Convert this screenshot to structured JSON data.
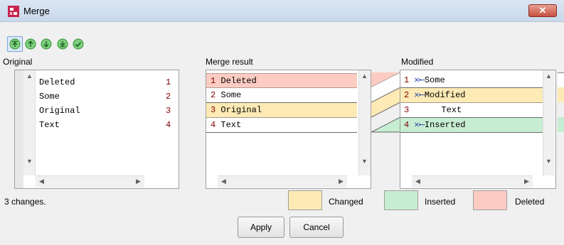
{
  "window": {
    "title": "Merge",
    "close_glyph": "✕"
  },
  "toolbar": {
    "buttons": [
      {
        "icon": "move-first-icon"
      },
      {
        "icon": "move-up-icon"
      },
      {
        "icon": "move-down-icon"
      },
      {
        "icon": "move-last-icon"
      },
      {
        "icon": "accept-icon"
      }
    ]
  },
  "original": {
    "label": "Original",
    "lines": [
      {
        "text": "Deleted",
        "num": "1"
      },
      {
        "text": "Some",
        "num": "2"
      },
      {
        "text": "Original",
        "num": "3"
      },
      {
        "text": "Text",
        "num": "4"
      }
    ]
  },
  "merge_result": {
    "label": "Merge result",
    "lines": [
      {
        "num": "1",
        "text": "Deleted",
        "state": "deleted"
      },
      {
        "num": "2",
        "text": "Some",
        "state": "none"
      },
      {
        "num": "3",
        "text": "Original",
        "state": "changed"
      },
      {
        "num": "4",
        "text": "Text",
        "state": "none"
      }
    ]
  },
  "modified": {
    "label": "Modified",
    "lines": [
      {
        "num": "1",
        "marker": "✕⟵",
        "text": "Some",
        "state": "none"
      },
      {
        "num": "2",
        "marker": "✕⟵",
        "text": "Modified",
        "state": "changed"
      },
      {
        "num": "3",
        "marker": "",
        "text": "Text",
        "state": "none"
      },
      {
        "num": "4",
        "marker": "✕⟵",
        "text": "Inserted",
        "state": "inserted"
      }
    ]
  },
  "status": {
    "text": "3 changes."
  },
  "legend": {
    "changed": {
      "label": "Changed",
      "color": "#fdeab5"
    },
    "inserted": {
      "label": "Inserted",
      "color": "#c7edd2"
    },
    "deleted": {
      "label": "Deleted",
      "color": "#fcccc2"
    }
  },
  "buttons": {
    "apply": "Apply",
    "cancel": "Cancel"
  }
}
